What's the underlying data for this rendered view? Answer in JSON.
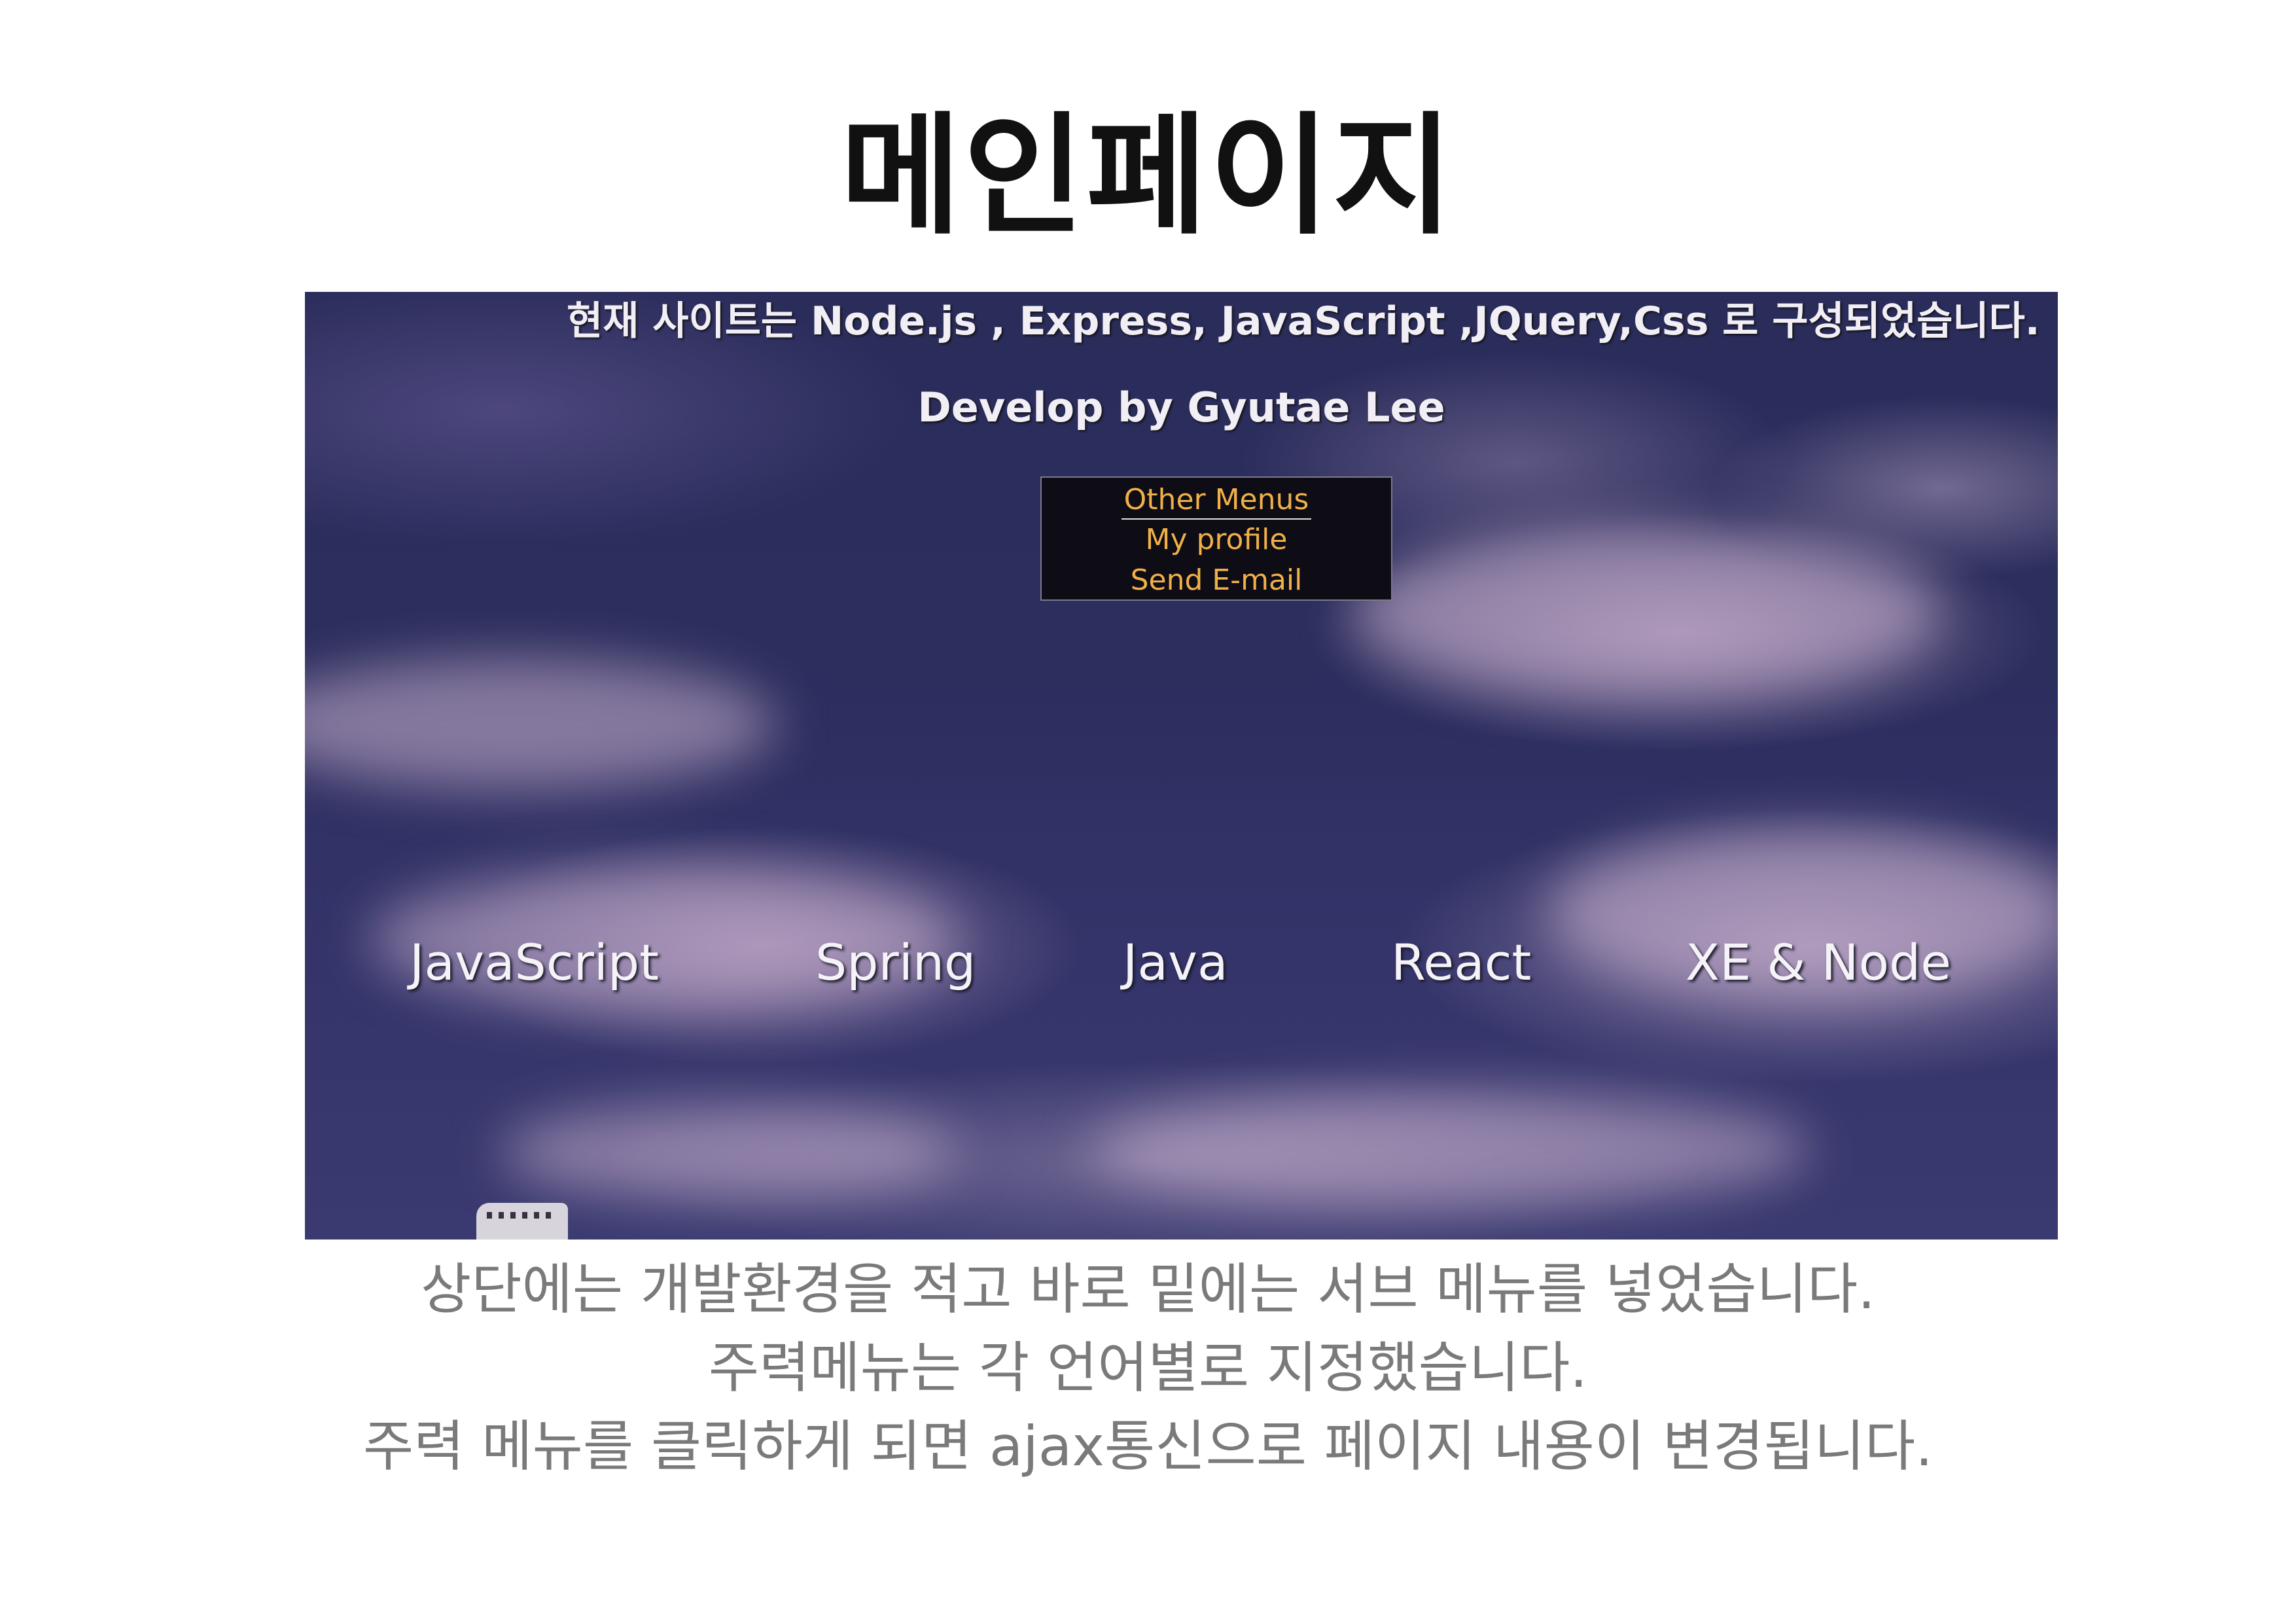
{
  "slide_title": "메인페이지",
  "site": {
    "dev_env_text": "현재 사이트는 Node.js , Express, JavaScript ,JQuery,Css 로 구성되었습니다.",
    "developer_text": "Develop by Gyutae Lee",
    "other_menus": {
      "heading": "Other Menus",
      "items": [
        "My profile",
        "Send E-mail"
      ]
    },
    "main_menu": [
      "JavaScript",
      "Spring",
      "Java",
      "React",
      "XE & Node"
    ]
  },
  "caption": {
    "lines": [
      "상단에는 개발환경을 적고 바로 밑에는 서브 메뉴를 넣었습니다.",
      "주력메뉴는 각 언어별로 지정했습니다.",
      "주력 메뉴를 클릭하게 되면 ajax통신으로 페이지 내용이 변경됩니다."
    ]
  },
  "colors": {
    "sky_dark": "#2a2c5a",
    "cloud": "#cdb4d2",
    "menu_text": "#f0b048",
    "caption_text": "#7a7a7a"
  }
}
